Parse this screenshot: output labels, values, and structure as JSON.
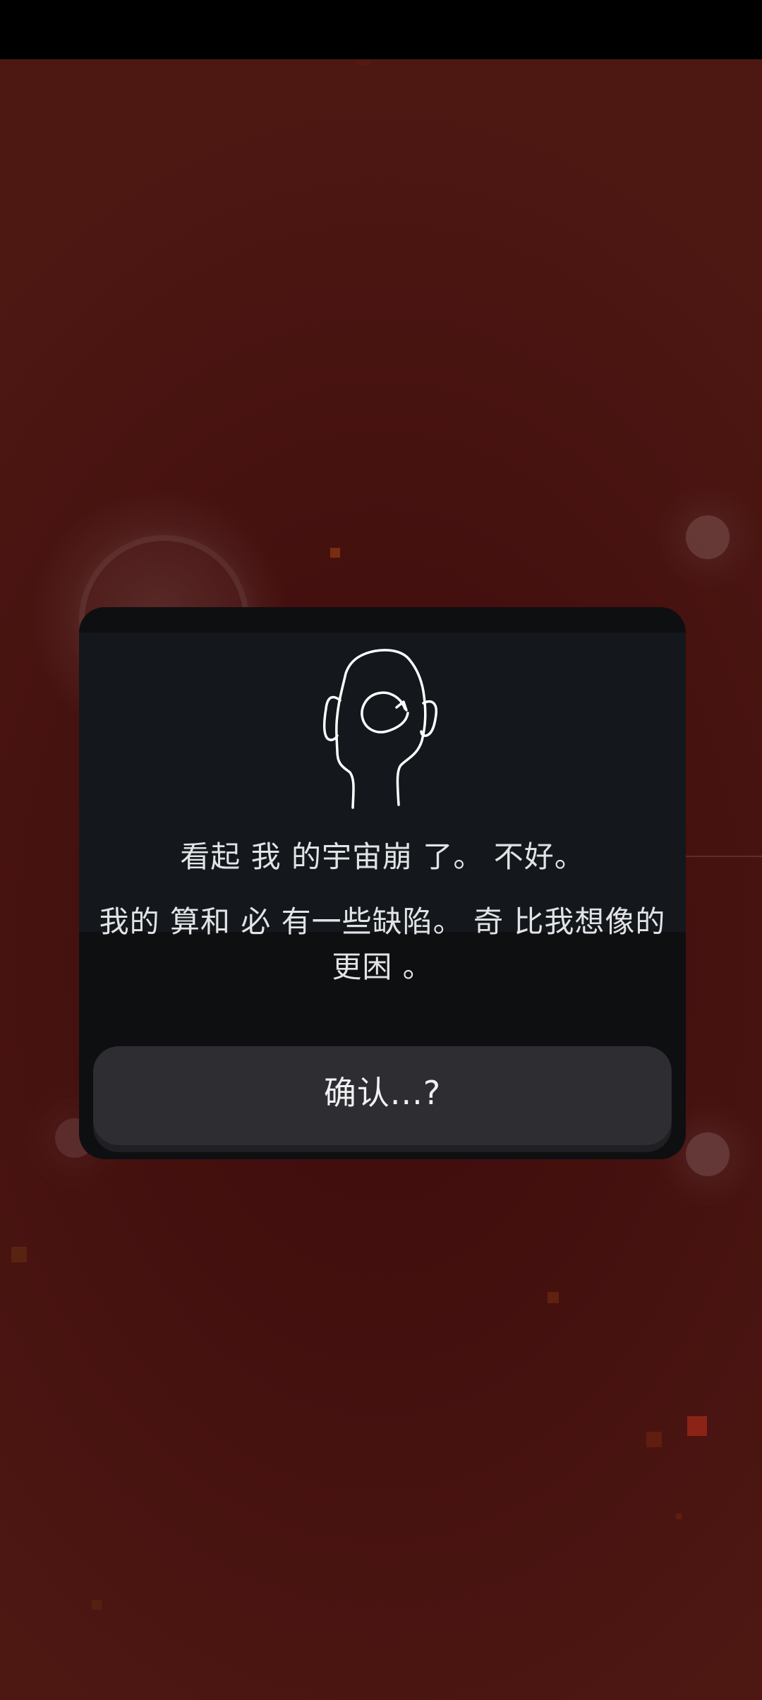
{
  "dialog": {
    "icon": "head-spiral-icon",
    "title": "看起 我 的宇宙崩 了。 不好。",
    "message": "我的 算和  必 有一些缺陷。  奇 比我想像的更困 。",
    "confirm_label": "确认...?"
  },
  "colors": {
    "background": "#461210",
    "dialog": "#14181d",
    "button": "#2d2d32",
    "text": "#e2e3e5"
  }
}
